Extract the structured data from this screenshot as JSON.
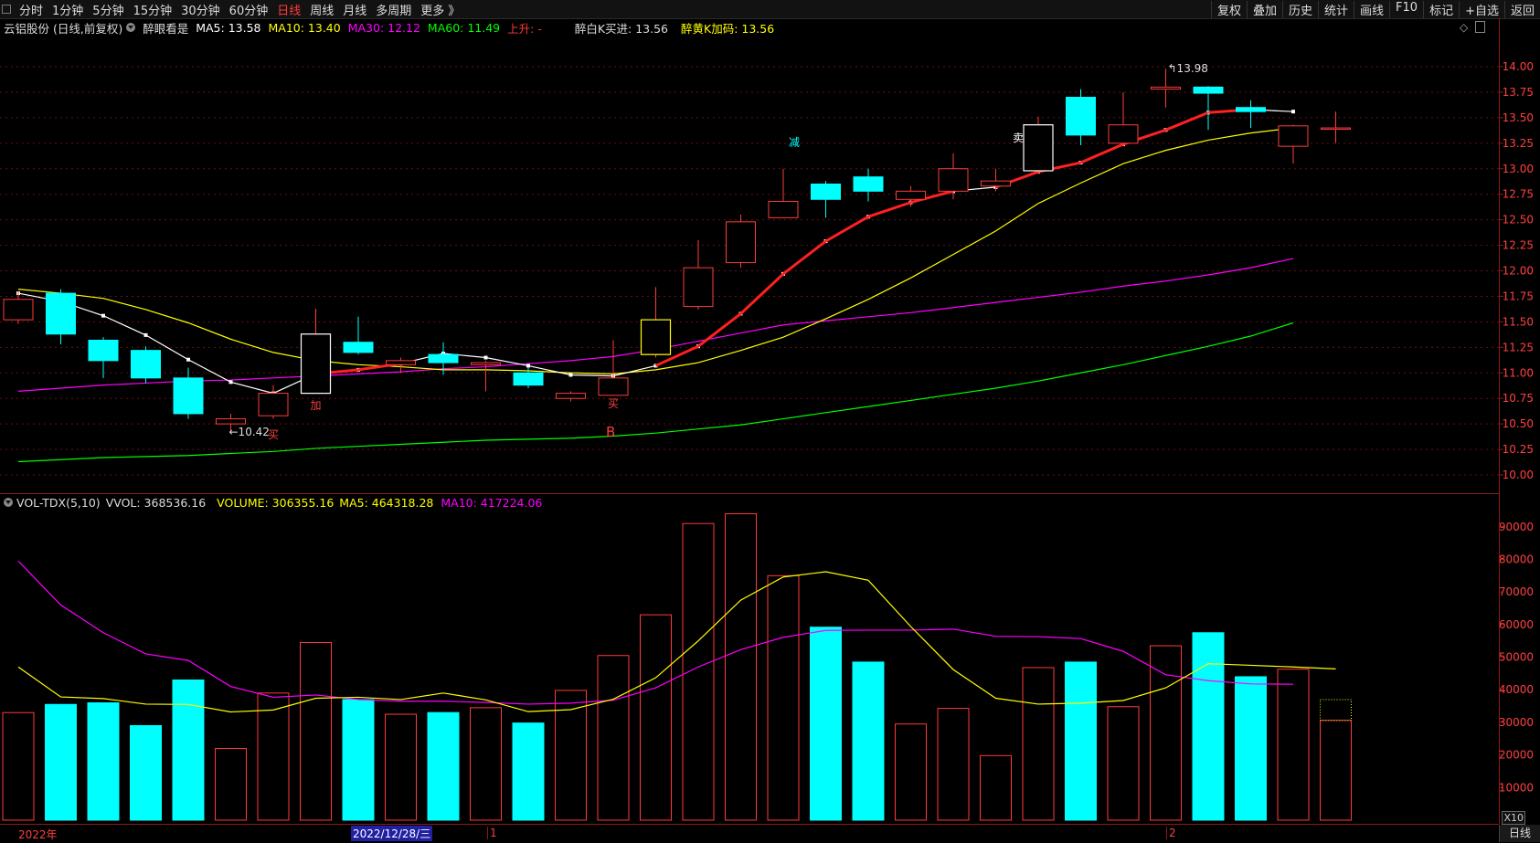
{
  "toolbar": {
    "periods": [
      "分时",
      "1分钟",
      "5分钟",
      "15分钟",
      "30分钟",
      "60分钟",
      "日线",
      "周线",
      "月线",
      "多周期",
      "更多 》"
    ],
    "active": "日线",
    "right_items": [
      "复权",
      "叠加",
      "历史",
      "统计",
      "画线",
      "F10",
      "标记",
      "+自选",
      "返回"
    ]
  },
  "price_panel": {
    "stock": "云铝股份 (日线,前复权)",
    "indicator": "醉眼看是",
    "ma5": "MA5: 13.58",
    "ma10": "MA10: 13.40",
    "ma30": "MA30: 12.12",
    "ma60": "MA60: 11.49",
    "trend": "上升: -",
    "k_buy": "醉白K买进: 13.56",
    "k_add": "醉黄K加码: 13.56",
    "high_label": "13.98",
    "low_label": "10.42",
    "marks": {
      "add": "加",
      "buy": "买",
      "reduce": "减",
      "sell": "卖",
      "b": "B"
    },
    "y_ticks": [
      "14.00",
      "13.75",
      "13.50",
      "13.25",
      "13.00",
      "12.75",
      "12.50",
      "12.25",
      "12.00",
      "11.75",
      "11.50",
      "11.25",
      "11.00",
      "10.75",
      "10.50",
      "10.25",
      "10.00"
    ]
  },
  "volume_panel": {
    "indicator": "VOL-TDX(5,10)",
    "vvol": "VVOL: 368536.16",
    "volume": "VOLUME: 306355.16",
    "ma5": "MA5: 464318.28",
    "ma10": "MA10: 417224.06",
    "y_ticks": [
      "90000",
      "80000",
      "70000",
      "60000",
      "50000",
      "40000",
      "30000",
      "20000",
      "10000"
    ],
    "scale": "X10"
  },
  "x_axis": {
    "labels": [
      "2022年",
      "1",
      "2"
    ],
    "cursor_date": "2022/12/28/三"
  },
  "period_label": "日线",
  "colors": {
    "up": "#ff3b3b",
    "down": "#00ffff",
    "ma5": "#ffffff",
    "ma10": "#ffff00",
    "ma30": "#ff00ff",
    "ma60": "#00ff00",
    "trend": "#ff2020"
  },
  "chart_data": {
    "type": "candlestick",
    "candles": [
      {
        "o": 11.52,
        "h": 11.8,
        "l": 11.48,
        "c": 11.72
      },
      {
        "o": 11.78,
        "h": 11.82,
        "l": 11.28,
        "c": 11.38
      },
      {
        "o": 11.32,
        "h": 11.35,
        "l": 10.95,
        "c": 11.12
      },
      {
        "o": 11.22,
        "h": 11.26,
        "l": 10.9,
        "c": 10.95
      },
      {
        "o": 10.95,
        "h": 11.05,
        "l": 10.55,
        "c": 10.6
      },
      {
        "o": 10.5,
        "h": 10.6,
        "l": 10.42,
        "c": 10.55
      },
      {
        "o": 10.58,
        "h": 10.88,
        "l": 10.55,
        "c": 10.8
      },
      {
        "o": 10.8,
        "h": 11.63,
        "l": 10.8,
        "c": 11.38
      },
      {
        "o": 11.3,
        "h": 11.55,
        "l": 11.18,
        "c": 11.2
      },
      {
        "o": 11.08,
        "h": 11.15,
        "l": 11.0,
        "c": 11.12
      },
      {
        "o": 11.18,
        "h": 11.3,
        "l": 10.98,
        "c": 11.1
      },
      {
        "o": 11.08,
        "h": 11.12,
        "l": 10.82,
        "c": 11.1
      },
      {
        "o": 11.0,
        "h": 11.05,
        "l": 10.85,
        "c": 10.88
      },
      {
        "o": 10.75,
        "h": 10.82,
        "l": 10.72,
        "c": 10.8
      },
      {
        "o": 10.78,
        "h": 11.32,
        "l": 10.78,
        "c": 10.95
      },
      {
        "o": 11.18,
        "h": 11.84,
        "l": 11.15,
        "c": 11.52
      },
      {
        "o": 11.65,
        "h": 12.3,
        "l": 11.62,
        "c": 12.03
      },
      {
        "o": 12.08,
        "h": 12.55,
        "l": 12.03,
        "c": 12.48
      },
      {
        "o": 12.52,
        "h": 13.0,
        "l": 12.52,
        "c": 12.68
      },
      {
        "o": 12.85,
        "h": 12.88,
        "l": 12.52,
        "c": 12.7
      },
      {
        "o": 12.92,
        "h": 13.0,
        "l": 12.68,
        "c": 12.78
      },
      {
        "o": 12.7,
        "h": 12.83,
        "l": 12.63,
        "c": 12.78
      },
      {
        "o": 12.78,
        "h": 13.15,
        "l": 12.7,
        "c": 13.0
      },
      {
        "o": 12.83,
        "h": 13.0,
        "l": 12.78,
        "c": 12.88
      },
      {
        "o": 12.98,
        "h": 13.51,
        "l": 12.98,
        "c": 13.43
      },
      {
        "o": 13.7,
        "h": 13.78,
        "l": 13.23,
        "c": 13.33
      },
      {
        "o": 13.25,
        "h": 13.75,
        "l": 13.22,
        "c": 13.43
      },
      {
        "o": 13.78,
        "h": 13.98,
        "l": 13.6,
        "c": 13.8
      },
      {
        "o": 13.8,
        "h": 13.81,
        "l": 13.38,
        "c": 13.74
      },
      {
        "o": 13.6,
        "h": 13.67,
        "l": 13.4,
        "c": 13.56
      },
      {
        "o": 13.22,
        "h": 13.43,
        "l": 13.05,
        "c": 13.42
      },
      {
        "o": 13.4,
        "h": 13.56,
        "l": 13.25,
        "c": 13.4
      }
    ],
    "ma5": [
      11.78,
      11.7,
      11.56,
      11.37,
      11.13,
      10.91,
      10.8,
      10.99,
      11.03,
      11.09,
      11.19,
      11.15,
      11.07,
      10.98,
      10.97,
      11.07,
      11.26,
      11.58,
      11.97,
      12.29,
      12.53,
      12.67,
      12.78,
      12.82,
      12.97,
      13.06,
      13.24,
      13.38,
      13.55,
      13.58,
      13.56
    ],
    "ma10": [
      11.82,
      11.78,
      11.73,
      11.62,
      11.49,
      11.33,
      11.2,
      11.12,
      11.08,
      11.06,
      11.03,
      11.03,
      11.02,
      11.0,
      10.99,
      11.03,
      11.1,
      11.22,
      11.35,
      11.53,
      11.72,
      11.93,
      12.16,
      12.39,
      12.66,
      12.86,
      13.05,
      13.18,
      13.28,
      13.35,
      13.4
    ],
    "ma30": [
      10.82,
      10.85,
      10.88,
      10.9,
      10.92,
      10.93,
      10.95,
      10.97,
      10.99,
      11.01,
      11.04,
      11.06,
      11.09,
      11.12,
      11.16,
      11.23,
      11.31,
      11.39,
      11.47,
      11.51,
      11.55,
      11.59,
      11.64,
      11.69,
      11.74,
      11.79,
      11.85,
      11.9,
      11.96,
      12.03,
      12.12
    ],
    "ma60": [
      10.13,
      10.15,
      10.17,
      10.18,
      10.19,
      10.21,
      10.23,
      10.26,
      10.28,
      10.3,
      10.32,
      10.34,
      10.35,
      10.36,
      10.38,
      10.41,
      10.45,
      10.49,
      10.55,
      10.61,
      10.67,
      10.73,
      10.79,
      10.85,
      10.92,
      11.0,
      11.08,
      11.17,
      11.26,
      11.36,
      11.49
    ],
    "volume": [
      33000,
      35500,
      36000,
      29000,
      43000,
      22000,
      39000,
      54500,
      37000,
      32500,
      33000,
      34500,
      29800,
      39800,
      50500,
      63000,
      91000,
      94000,
      75000,
      59200,
      48500,
      29500,
      34300,
      19800,
      46800,
      48500,
      34800,
      53500,
      57500,
      44000,
      46300,
      30600
    ],
    "vol_ma5": [
      47000,
      37800,
      37300,
      35600,
      35500,
      33200,
      33800,
      37400,
      37700,
      37000,
      39000,
      36900,
      33300,
      33900,
      37100,
      43700,
      55000,
      67500,
      74600,
      76200,
      73600,
      59400,
      46200,
      37400,
      35600,
      35900,
      36700,
      40600,
      48000,
      47500,
      47000,
      46400
    ],
    "vol_ma10": [
      79500,
      66000,
      57500,
      51000,
      49000,
      41000,
      37700,
      38400,
      37000,
      36500,
      36500,
      36100,
      35600,
      35900,
      36800,
      40600,
      47000,
      52300,
      56100,
      58200,
      58300,
      58300,
      58600,
      56400,
      56300,
      55700,
      51800,
      44600,
      42800,
      41800,
      41700
    ]
  }
}
